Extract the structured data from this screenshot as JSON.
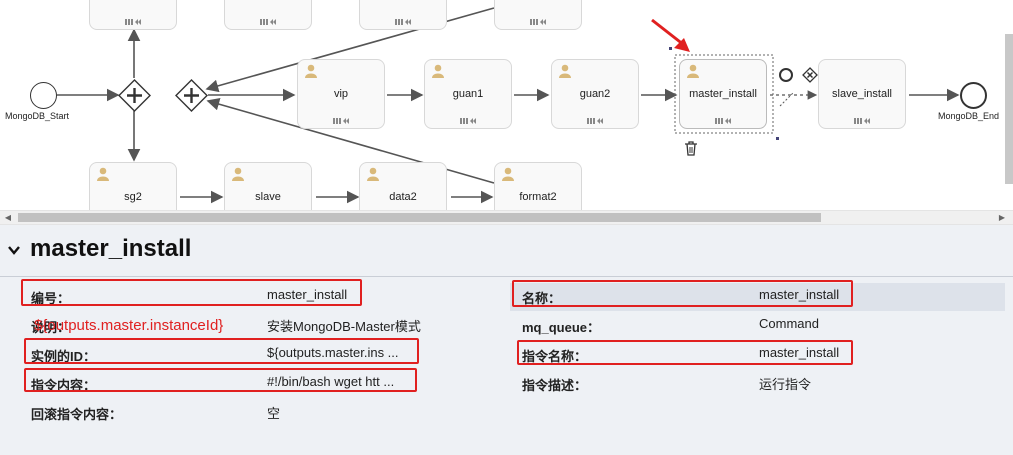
{
  "diagram": {
    "nodes": {
      "vip": "vip",
      "guan1": "guan1",
      "guan2": "guan2",
      "master_install": "master_install",
      "slave_install": "slave_install",
      "sg2": "sg2",
      "slave": "slave",
      "data2": "data2",
      "format2": "format2"
    },
    "start_label": "MongoDB_Start",
    "end_label": "MongoDB_End"
  },
  "properties": {
    "title": "master_install",
    "left": [
      {
        "key": "编号：",
        "value": "master_install"
      },
      {
        "key": "说明：",
        "value": "安装MongoDB-Master模式"
      },
      {
        "key": "实例的ID：",
        "value": "${outputs.master.ins ..."
      },
      {
        "key": "指令内容：",
        "value": "#!/bin/bash wget htt ..."
      },
      {
        "key": "回滚指令内容：",
        "value": "空"
      }
    ],
    "right": [
      {
        "key": "名称：",
        "value": "master_install"
      },
      {
        "key": "mq_queue：",
        "value": "Command"
      },
      {
        "key": "指令名称：",
        "value": "master_install"
      },
      {
        "key": "指令描述：",
        "value": "运行指令"
      }
    ],
    "annotation": "${outputs.master.instanceId}"
  },
  "colors": {
    "accent_red": "#e02020",
    "panel_bg": "#eef1f5",
    "node_bg": "#f9f9f9",
    "user_icon": "#d9b97a"
  }
}
